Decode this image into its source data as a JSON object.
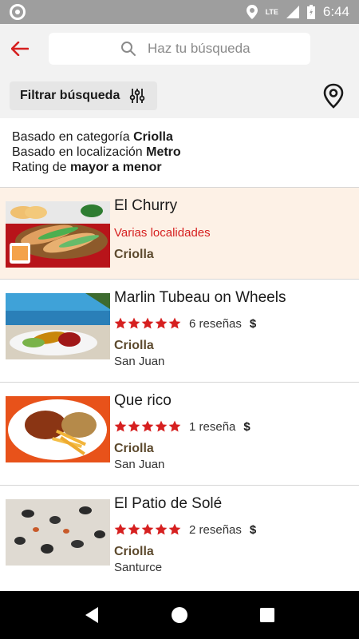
{
  "status_bar": {
    "time": "6:44",
    "network": "LTE"
  },
  "header": {
    "search_placeholder": "Haz tu búsqueda"
  },
  "filter": {
    "label": "Filtrar búsqueda"
  },
  "criteria": [
    {
      "prefix": "Basado en categoría ",
      "value": "Criolla"
    },
    {
      "prefix": "Basado en localización ",
      "value": "Metro"
    },
    {
      "prefix": "Rating de ",
      "value": "mayor a menor"
    }
  ],
  "results": [
    {
      "name": "El Churry",
      "subtitle": "Varias localidades",
      "category": "Criolla",
      "highlight": true
    },
    {
      "name": "Marlin Tubeau on Wheels",
      "stars": 5,
      "reviews": "6 reseñas",
      "price": "$",
      "category": "Criolla",
      "location": "San Juan"
    },
    {
      "name": "Que rico",
      "stars": 5,
      "reviews": "1 reseña",
      "price": "$",
      "category": "Criolla",
      "location": "San Juan"
    },
    {
      "name": "El Patio de Solé",
      "stars": 5,
      "reviews": "2 reseñas",
      "price": "$",
      "category": "Criolla",
      "location": "Santurce"
    }
  ],
  "colors": {
    "accent": "#d62020",
    "highlight_bg": "#fdf1e6",
    "category": "#5d4a2e"
  },
  "icons": [
    "back-arrow-icon",
    "search-icon",
    "sliders-icon",
    "location-pin-icon",
    "star-icon",
    "nav-back-icon",
    "nav-home-icon",
    "nav-recents-icon"
  ]
}
